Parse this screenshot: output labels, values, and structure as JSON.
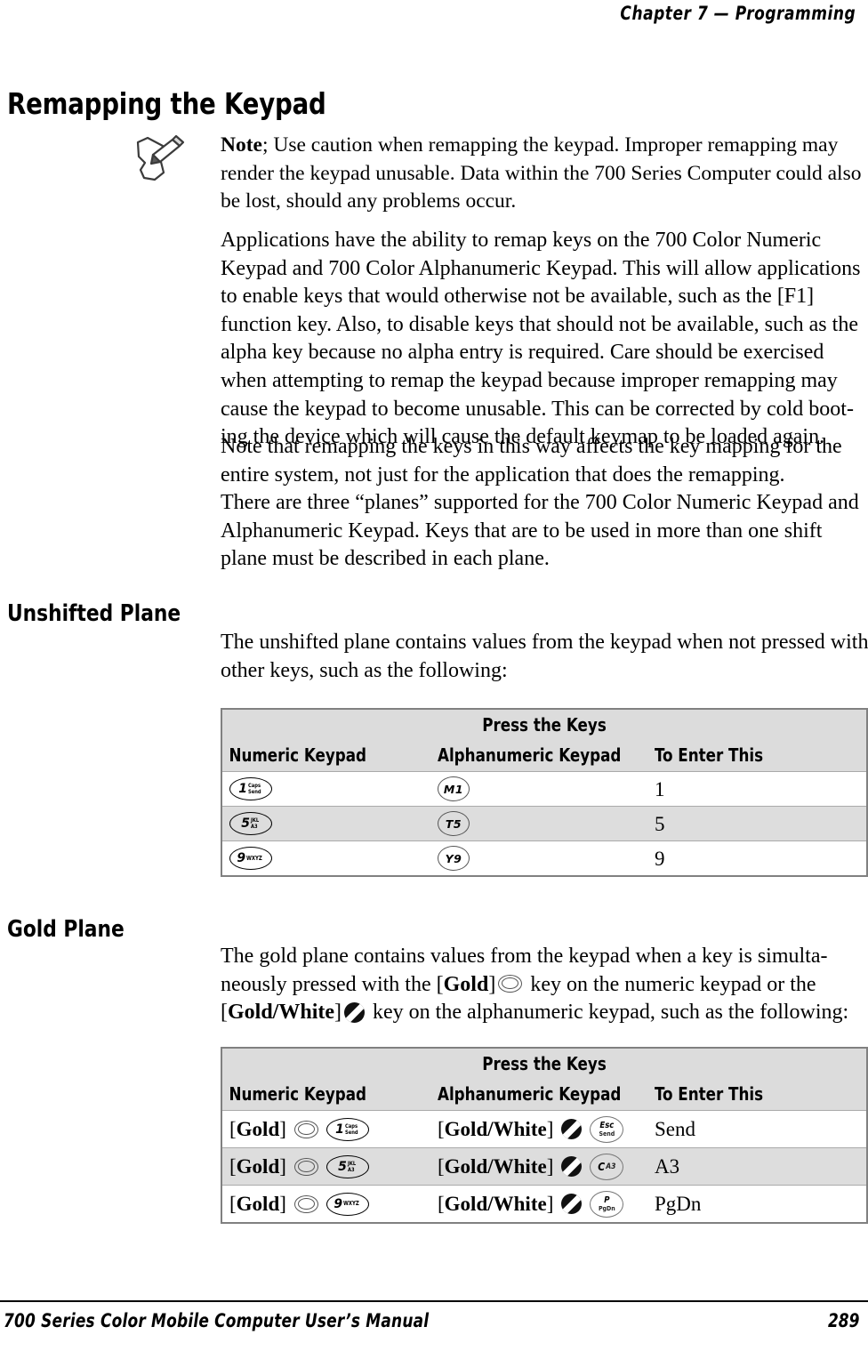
{
  "header": {
    "running_head": "Chapter  7  —  Programming"
  },
  "title": "Remapping the Keypad",
  "note": {
    "icon": "note-pencil-icon",
    "label": "Note",
    "text": "; Use caution when remapping the keypad. Improper remapping may render the keypad unusable. Data within the 700 Series Computer could also be lost, should any problems occur."
  },
  "paragraphs": {
    "applications": "Applications have the ability to remap keys on the 700 Color Numeric Keypad and 700 Color Alphanumeric Keypad. This will allow applications to enable keys that would otherwise not be available, such as the [F1] function key. Also, to disable keys that should not be available, such as the alpha key because no alpha entry is required. Care should be exercised when attempting to remap the keypad because improper remapping may cause the keypad to become unusable. This can be corrected by cold boot-ing the device which will cause the default keymap to be loaded again.",
    "note_remapping": "Note that remapping the keys in this way affects the key mapping for the entire system, not just for the application that does the remapping.",
    "three_planes": "There are three “planes” supported for the 700 Color Numeric Keypad and Alphanumeric Keypad. Keys that are to be used in more than one shift plane must be described in each plane.",
    "unshifted_intro": "The unshifted plane contains values from the keypad when not pressed with other keys, such as the following:",
    "gold_intro_1": "The gold plane contains values from the keypad when a key is simulta-neously pressed with the [",
    "gold_label_1": "Gold",
    "gold_intro_2": "]",
    "gold_intro_3": " key on the numeric keypad or the [",
    "gold_label_2": "Gold/White",
    "gold_intro_4": "]",
    "gold_intro_5": " key on the alphanumeric keypad, such as the following:"
  },
  "sections": {
    "unshifted_plane": "Unshifted Plane",
    "gold_plane": "Gold Plane"
  },
  "table_unshifted": {
    "title": "Press the Keys",
    "columns": [
      "Numeric Keypad",
      "Alphanumeric Keypad",
      "To Enter This"
    ],
    "rows": [
      {
        "numeric_key": {
          "main": "1",
          "sub_top": "Caps",
          "sub_bottom": "Send"
        },
        "alpha_key": {
          "text": "M1"
        },
        "enter": "1"
      },
      {
        "numeric_key": {
          "main": "5",
          "sub_top": "JKL",
          "sub_bottom": "A3"
        },
        "alpha_key": {
          "text": "T5"
        },
        "enter": "5"
      },
      {
        "numeric_key": {
          "main": "9",
          "sub_inline": "WXYZ"
        },
        "alpha_key": {
          "text": "Y9"
        },
        "enter": "9"
      }
    ]
  },
  "table_gold": {
    "title": "Press the Keys",
    "columns": [
      "Numeric Keypad",
      "Alphanumeric Keypad",
      "To Enter This"
    ],
    "gold_bracket_open": "[",
    "gold_bracket_close": "]",
    "gold_label": "Gold",
    "goldwhite_label": "Gold/White",
    "rows": [
      {
        "numeric_key": {
          "main": "1",
          "sub_top": "Caps",
          "sub_bottom": "Send"
        },
        "alpha_key": {
          "line1": "Esc",
          "line2": "Send"
        },
        "enter": "Send"
      },
      {
        "numeric_key": {
          "main": "5",
          "sub_top": "JKL",
          "sub_bottom": "A3"
        },
        "alpha_key": {
          "line1": "C",
          "line2": "A3",
          "inline": true
        },
        "enter": "A3"
      },
      {
        "numeric_key": {
          "main": "9",
          "sub_inline": "WXYZ"
        },
        "alpha_key": {
          "line1": "P",
          "line2": "PgDn"
        },
        "enter": "PgDn"
      }
    ]
  },
  "footer": {
    "manual_title": "700 Series Color Mobile Computer User’s Manual",
    "page_number": "289"
  },
  "colors": {
    "table_border": "#808080",
    "header_fill": "#dcdcdc",
    "row_shaded": "#dddddd",
    "text": "#000000"
  }
}
